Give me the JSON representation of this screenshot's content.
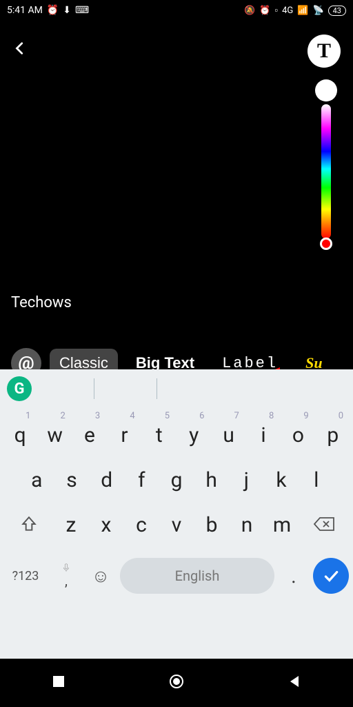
{
  "status": {
    "time": "5:41 AM",
    "battery": "43",
    "network": "4G"
  },
  "editor": {
    "text_overlay": "Techows",
    "text_tool": "T"
  },
  "fonts": {
    "mention": "@",
    "classic": "Classic",
    "big": "Big Text",
    "label": "Label",
    "suffix": "Su"
  },
  "keyboard": {
    "row1_nums": [
      "1",
      "2",
      "3",
      "4",
      "5",
      "6",
      "7",
      "8",
      "9",
      "0"
    ],
    "row1": [
      "q",
      "w",
      "e",
      "r",
      "t",
      "y",
      "u",
      "i",
      "o",
      "p"
    ],
    "row2": [
      "a",
      "s",
      "d",
      "f",
      "g",
      "h",
      "j",
      "k",
      "l"
    ],
    "row3": [
      "z",
      "x",
      "c",
      "v",
      "b",
      "n",
      "m"
    ],
    "symbols": "?123",
    "mic": ",",
    "space": "English",
    "period": "."
  }
}
